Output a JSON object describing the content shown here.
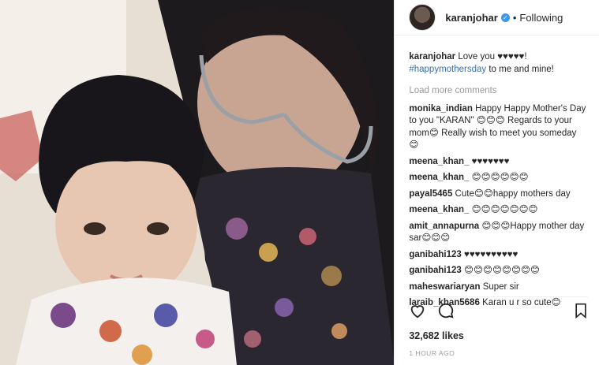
{
  "header": {
    "username": "karanjohar",
    "separator": "•",
    "follow_label": "Following"
  },
  "caption": {
    "user": "karanjohar",
    "text": "Love you ♥♥♥♥♥!",
    "hashtag": "#happymothersday",
    "text2": " to me and mine!"
  },
  "load_more_label": "Load more comments",
  "comments": [
    {
      "user": "monika_indian",
      "text": "Happy Happy Mother's Day to you \"KARAN\" 😊😊😊 Regards to your mom😊 Really wish to meet you someday 😊"
    },
    {
      "user": "meena_khan_",
      "text": "♥♥♥♥♥♥♥"
    },
    {
      "user": "meena_khan_",
      "text": "😊😊😊😊😊😊"
    },
    {
      "user": "payal5465",
      "text": "Cute😊😊happy mothers day"
    },
    {
      "user": "meena_khan_",
      "text": "😊😊😊😊😊😊😊"
    },
    {
      "user": "amit_annapurna",
      "text": "😊😊😊Happy mother day sar😊😊😊"
    },
    {
      "user": "ganibahi123",
      "text": "♥♥♥♥♥♥♥♥♥♥"
    },
    {
      "user": "ganibahi123",
      "text": "😊😊😊😊😊😊😊😊"
    },
    {
      "user": "maheswariaryan",
      "text": "Super sir"
    },
    {
      "user": "laraib_khan5686",
      "text": "Karan u r so cute😊"
    }
  ],
  "likes_label": "32,682 likes",
  "time_label": "1 HOUR AGO",
  "colors": {
    "accent": "#3897f0",
    "muted": "#999999"
  },
  "icons": [
    "heart-icon",
    "comment-icon",
    "bookmark-icon"
  ]
}
